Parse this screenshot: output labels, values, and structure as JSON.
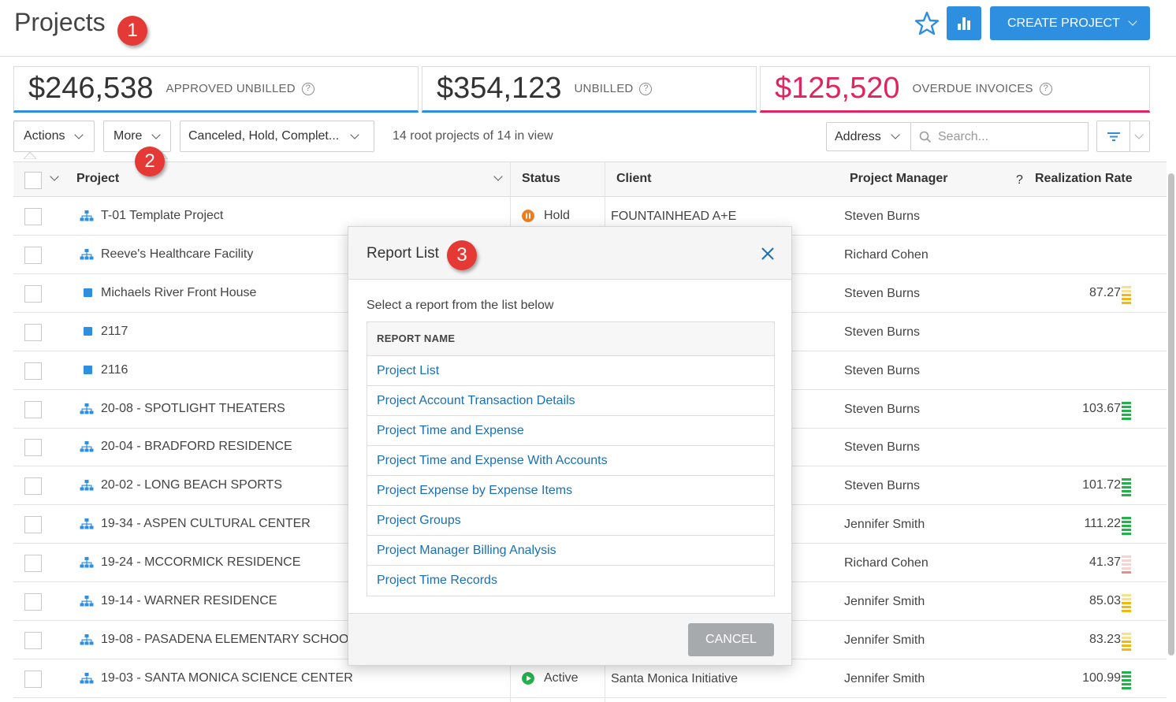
{
  "header": {
    "title": "Projects",
    "create_label": "CREATE PROJECT",
    "accent": "#2e8fe0"
  },
  "badges": [
    "1",
    "2",
    "3"
  ],
  "summary": [
    {
      "amount": "$246,538",
      "label": "APPROVED UNBILLED",
      "color": "#2e8fe0"
    },
    {
      "amount": "$354,123",
      "label": "UNBILLED",
      "color": "#2e8fe0"
    },
    {
      "amount": "$125,520",
      "label": "OVERDUE INVOICES",
      "color": "#e0245e"
    }
  ],
  "toolbar": {
    "actions_label": "Actions",
    "more_label": "More",
    "status_filter": "Canceled, Hold, Complet...",
    "info": "14 root projects of 14 in view",
    "address_label": "Address",
    "search_placeholder": "Search..."
  },
  "table": {
    "columns": {
      "project": "Project",
      "status": "Status",
      "client": "Client",
      "manager": "Project Manager",
      "rate": "Realization Rate"
    },
    "rows": [
      {
        "icon": "hierarchy-icon",
        "name": "T-01 Template Project",
        "status": "Hold",
        "status_kind": "hold",
        "client": "FOUNTAINHEAD A+E",
        "manager": "Steven Burns",
        "rate": "",
        "level": ""
      },
      {
        "icon": "hierarchy-icon",
        "name": "Reeve's Healthcare Facility",
        "status": "",
        "status_kind": "",
        "client": "",
        "manager": "Richard Cohen",
        "rate": "",
        "level": ""
      },
      {
        "icon": "square-icon",
        "name": "Michaels River Front House",
        "status": "",
        "status_kind": "",
        "client": "",
        "manager": "Steven Burns",
        "rate": "87.27",
        "level": "yellow"
      },
      {
        "icon": "square-icon",
        "name": "2117",
        "status": "",
        "status_kind": "",
        "client": "",
        "manager": "Steven Burns",
        "rate": "",
        "level": ""
      },
      {
        "icon": "square-icon",
        "name": "2116",
        "status": "",
        "status_kind": "",
        "client": "",
        "manager": "Steven Burns",
        "rate": "",
        "level": ""
      },
      {
        "icon": "hierarchy-icon",
        "name": "20-08 - SPOTLIGHT THEATERS",
        "status": "",
        "status_kind": "",
        "client": "",
        "manager": "Steven Burns",
        "rate": "103.67",
        "level": "green"
      },
      {
        "icon": "hierarchy-icon",
        "name": "20-04 - BRADFORD RESIDENCE",
        "status": "",
        "status_kind": "",
        "client": "",
        "manager": "Steven Burns",
        "rate": "",
        "level": ""
      },
      {
        "icon": "hierarchy-icon",
        "name": "20-02 - LONG BEACH SPORTS",
        "status": "",
        "status_kind": "",
        "client": "",
        "manager": "Steven Burns",
        "rate": "101.72",
        "level": "green"
      },
      {
        "icon": "hierarchy-icon",
        "name": "19-34 - ASPEN CULTURAL CENTER",
        "status": "",
        "status_kind": "",
        "client": "",
        "manager": "Jennifer Smith",
        "rate": "111.22",
        "level": "green"
      },
      {
        "icon": "hierarchy-icon",
        "name": "19-24 - MCCORMICK RESIDENCE",
        "status": "",
        "status_kind": "",
        "client": "",
        "manager": "Richard Cohen",
        "rate": "41.37",
        "level": "red"
      },
      {
        "icon": "hierarchy-icon",
        "name": "19-14 - WARNER RESIDENCE",
        "status": "",
        "status_kind": "",
        "client": "",
        "manager": "Jennifer Smith",
        "rate": "85.03",
        "level": "yellow"
      },
      {
        "icon": "hierarchy-icon",
        "name": "19-08 - PASADENA ELEMENTARY SCHOO",
        "status": "",
        "status_kind": "",
        "client": "",
        "manager": "Jennifer Smith",
        "rate": "83.23",
        "level": "yellow"
      },
      {
        "icon": "hierarchy-icon",
        "name": "19-03 - SANTA MONICA SCIENCE CENTER",
        "status": "Active",
        "status_kind": "active",
        "client": "Santa Monica Initiative",
        "manager": "Jennifer Smith",
        "rate": "100.99",
        "level": "green"
      }
    ]
  },
  "modal": {
    "title": "Report List",
    "subtitle": "Select a report from the list below",
    "column_header": "REPORT NAME",
    "reports": [
      "Project List",
      "Project Account Transaction Details",
      "Project Time and Expense",
      "Project Time and Expense With Accounts",
      "Project Expense by Expense Items",
      "Project Groups",
      "Project Manager Billing Analysis",
      "Project Time Records"
    ],
    "cancel_label": "CANCEL"
  }
}
